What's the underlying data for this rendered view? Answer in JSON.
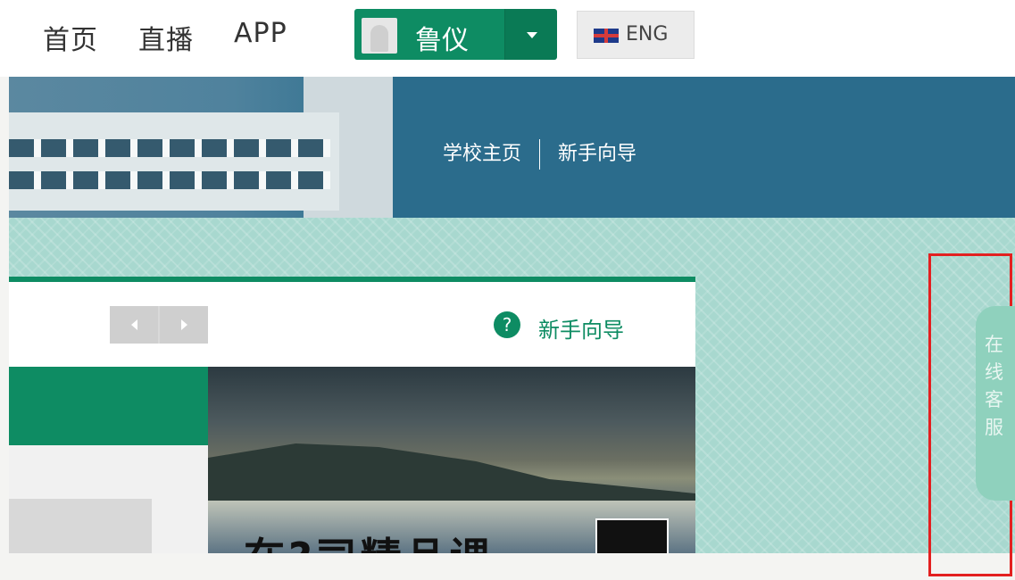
{
  "top_nav": {
    "links": [
      "首页",
      "直播",
      "APP"
    ],
    "user": {
      "name": "鲁仪"
    },
    "language": {
      "label": "ENG"
    }
  },
  "header": {
    "links": [
      "学校主页",
      "新手向导"
    ]
  },
  "panel": {
    "help_label": "新手向导",
    "slide_text": "在?司精品课"
  },
  "sidebar": {
    "service_label": "在线客服"
  },
  "colors": {
    "brand_green": "#0e8c63",
    "banner_blue": "#2b6c8c",
    "pattern_mint": "#a8d8cf",
    "highlight_red": "#e32020"
  },
  "icons": [
    "avatar-icon",
    "caret-down-icon",
    "uk-flag-icon",
    "chevron-left-icon",
    "chevron-right-icon",
    "help-icon"
  ]
}
